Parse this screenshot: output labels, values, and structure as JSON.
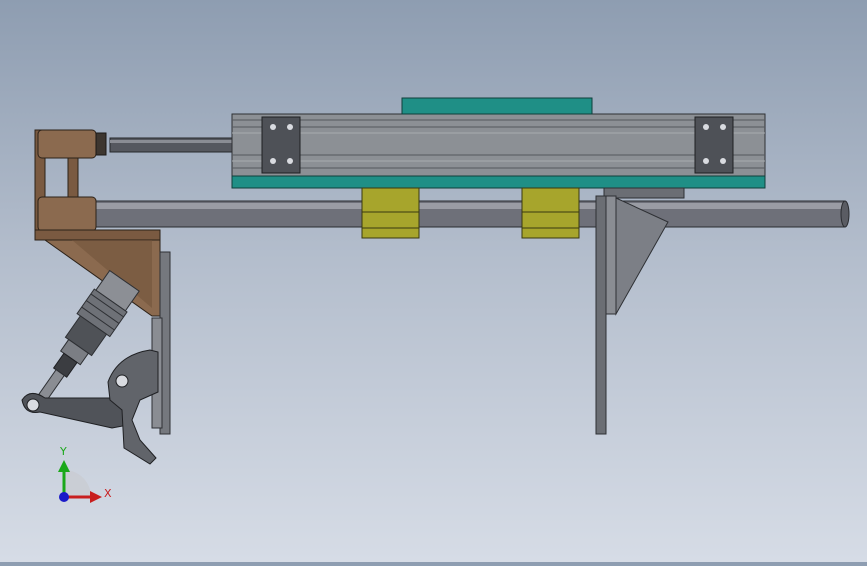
{
  "viewport": {
    "background_top": "#8e9db1",
    "background_bottom": "#d6dce6"
  },
  "triad": {
    "y_label": "Y",
    "x_label": "X",
    "y_color": "#1aa81a",
    "x_color": "#c81e1e",
    "z_color": "#1a1ac8"
  },
  "colors": {
    "profile": "#8c9095",
    "profile_dark": "#5f6368",
    "teal": "#1f8f86",
    "olive": "#a7a52c",
    "bronze": "#8b6a4f",
    "rod": "#6e7079",
    "steel": "#7c7f86",
    "bracket": "#6b6e74"
  }
}
